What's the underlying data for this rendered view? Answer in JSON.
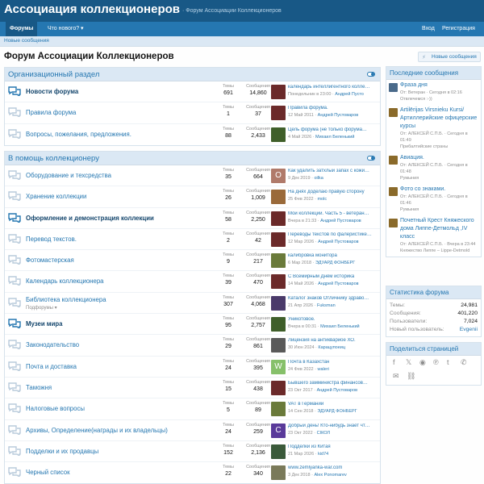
{
  "header": {
    "title": "Ассоциация коллекционеров",
    "subtitle": "· Форум Ассоциации Коллекционеров"
  },
  "nav": {
    "tabs": [
      {
        "label": "Форумы",
        "active": true
      },
      {
        "label": "Что нового? ▾",
        "active": false
      }
    ],
    "login": "Вход",
    "register": "Регистрация"
  },
  "subnav": {
    "item": "Новые сообщения"
  },
  "page": {
    "title": "Форум Ассоциации Коллекционеров",
    "new_posts_button": "Новые сообщения"
  },
  "labels": {
    "threads": "Темы",
    "messages": "Сообщения"
  },
  "colors": {
    "accent": "#2577b1",
    "header": "#185886",
    "nav": "#2577b1"
  },
  "categories": [
    {
      "title": "Организационный раздел",
      "nodes": [
        {
          "title": "Новости форума",
          "unread": true,
          "threads": "691",
          "messages": "14,860",
          "last_title": "календарь интеллигентного колле…",
          "last_date": "Понедельник в 23:00",
          "last_user": "Андрей Пусто",
          "avatar_color": "#6b2a2a",
          "avatar_letter": ""
        },
        {
          "title": "Правила форума",
          "unread": false,
          "threads": "1",
          "messages": "37",
          "last_title": "Правила форума.",
          "last_date": "12 Май 2011",
          "last_user": "Андрей Пустоваров",
          "avatar_color": "#6b2a2a",
          "avatar_letter": ""
        },
        {
          "title": "Вопросы, пожелания, предложения.",
          "unread": false,
          "threads": "88",
          "messages": "2,433",
          "last_title": "Цель форума (не только форума…",
          "last_date": "4 Май 2026",
          "last_user": "Михаил Беленький",
          "avatar_color": "#3f5f2a",
          "avatar_letter": ""
        }
      ]
    },
    {
      "title": "В помощь коллекционеру",
      "nodes": [
        {
          "title": "Оборудование и техсредства",
          "unread": false,
          "threads": "35",
          "messages": "664",
          "last_title": "Как удалить затхлый запах с кожи…",
          "last_date": "9 Дек 2019",
          "last_user": "oilka",
          "avatar_color": "#b07a6a",
          "avatar_letter": "O"
        },
        {
          "title": "Хранение коллекции",
          "unread": false,
          "threads": "26",
          "messages": "1,009",
          "last_title": "На днях доделаю правую сторону",
          "last_date": "25 Фев 2022",
          "last_user": "molc",
          "avatar_color": "#9a6a3a",
          "avatar_letter": ""
        },
        {
          "title": "Оформление и демонстрация коллекции",
          "unread": true,
          "threads": "58",
          "messages": "2,250",
          "last_title": "Мои коллекции. Часть 5 - ветеран…",
          "last_date": "Вчера в 21:33",
          "last_user": "Андрей Пустоваров",
          "avatar_color": "#6b2a2a",
          "avatar_letter": ""
        },
        {
          "title": "Перевод текстов.",
          "unread": false,
          "threads": "2",
          "messages": "42",
          "last_title": "Переводы текстов по фалеристике…",
          "last_date": "12 Мар 2026",
          "last_user": "Андрей Пустоваров",
          "avatar_color": "#6b2a2a",
          "avatar_letter": ""
        },
        {
          "title": "Фотомастерская",
          "unread": false,
          "threads": "9",
          "messages": "217",
          "last_title": "калибровка монитора",
          "last_date": "6 Мар 2018",
          "last_user": "ЭДУАРД ФОНБЕРГ",
          "avatar_color": "#6a7a3a",
          "avatar_letter": ""
        },
        {
          "title": "Календарь коллекционера",
          "unread": false,
          "threads": "39",
          "messages": "470",
          "last_title": "С Всемирным Днём историка",
          "last_date": "14 Май 2026",
          "last_user": "Андрей Пустоваров",
          "avatar_color": "#6b2a2a",
          "avatar_letter": ""
        },
        {
          "title": "Библиотека коллекционера",
          "subforums": "Подфорумы ▾",
          "unread": false,
          "threads": "307",
          "messages": "4,068",
          "last_title": "Каталог знаков Отличнику здраво…",
          "last_date": "21 Апр 2026",
          "last_user": "Fuksman",
          "avatar_color": "#4a3a6a",
          "avatar_letter": ""
        },
        {
          "title": "Музеи мира",
          "unread": true,
          "threads": "95",
          "messages": "2,757",
          "last_title": "Уникотовое.",
          "last_date": "Вчера в 00:31",
          "last_user": "Михаил Беленький",
          "avatar_color": "#3f5f2a",
          "avatar_letter": ""
        },
        {
          "title": "Законодательство",
          "unread": false,
          "threads": "29",
          "messages": "861",
          "last_title": "Лицензия на антиквариое ХО.",
          "last_date": "30 Июн 2024",
          "last_user": "Карацупоеиц",
          "avatar_color": "#5a5a5a",
          "avatar_letter": ""
        },
        {
          "title": "Почта и доставка",
          "unread": false,
          "threads": "24",
          "messages": "395",
          "last_title": "Почта в Казахстан",
          "last_date": "24 Фев 2022",
          "last_user": "waleri",
          "avatar_color": "#86c06a",
          "avatar_letter": "W"
        },
        {
          "title": "Таможня",
          "unread": false,
          "threads": "15",
          "messages": "438",
          "last_title": "Бывшего замминистра финансов…",
          "last_date": "23 Окт 2017",
          "last_user": "Андрей Пустоваров",
          "avatar_color": "#6b2a2a",
          "avatar_letter": ""
        },
        {
          "title": "Налоговые вопросы",
          "unread": false,
          "threads": "5",
          "messages": "89",
          "last_title": "VAT в Германии",
          "last_date": "14 Сен 2018",
          "last_user": "ЭДУАРД ФОНБЕРГ",
          "avatar_color": "#6a7a3a",
          "avatar_letter": ""
        },
        {
          "title": "Архивы, Определение(награды и их владельцы)",
          "unread": false,
          "threads": "24",
          "messages": "259",
          "last_title": "Добрый день! Кто-нибудь знает чт…",
          "last_date": "23 Окт 2022",
          "last_user": "СІКОЛ",
          "avatar_color": "#5a3a9a",
          "avatar_letter": "С"
        },
        {
          "title": "Подделки и их продавцы",
          "unread": false,
          "threads": "152",
          "messages": "2,136",
          "last_title": "Подделки из Китая",
          "last_date": "21 Мар 2026",
          "last_user": "kid74",
          "avatar_color": "#3a5a3a",
          "avatar_letter": ""
        },
        {
          "title": "Черный список",
          "unread": false,
          "threads": "22",
          "messages": "340",
          "last_title": "www.zemlyanka-war.com",
          "last_date": "3 Дек 2018",
          "last_user": "Alex Ponomarev",
          "avatar_color": "#7a7a5a",
          "avatar_letter": ""
        }
      ]
    }
  ],
  "sidebar": {
    "new_posts": {
      "title": "Последние сообщения",
      "items": [
        {
          "title": "Фраза дня",
          "meta": "От: Ветеран · Сегодня в 02:16",
          "sub": "Отвлечемся :-))",
          "avatar_color": "#4a6a8a"
        },
        {
          "title": "Artilērijas Virsnieku Kursi/ Артиллерийские офицерские курсы",
          "meta": "От: АЛЕКСЕЙ С.П.Б. · Сегодня в 01:49",
          "sub": "Прибалтийские страны",
          "avatar_color": "#8a6a2a"
        },
        {
          "title": "Авиация.",
          "meta": "От: АЛЕКСЕЙ С.П.Б. · Сегодня в 01:48",
          "sub": "Румыния",
          "avatar_color": "#8a6a2a"
        },
        {
          "title": "Фото со знаками.",
          "meta": "От: АЛЕКСЕЙ С.П.Б. · Сегодня в 01:46",
          "sub": "Румыния",
          "avatar_color": "#8a6a2a"
        },
        {
          "title": "Почетный Крест Княжеского дома Липпе-Детмольд ,IV класс",
          "meta": "От: АЛЕКСЕЙ С.П.Б. · Вчера в 23:44",
          "sub": "Княжество Липпе – Lippe-Detmold",
          "avatar_color": "#8a6a2a"
        }
      ]
    },
    "stats": {
      "title": "Статистика форума",
      "rows": [
        {
          "label": "Темы:",
          "value": "24,981"
        },
        {
          "label": "Сообщения:",
          "value": "401,220"
        },
        {
          "label": "Пользователи:",
          "value": "7,024"
        },
        {
          "label": "Новый пользователь:",
          "value": "Evgenii"
        }
      ]
    },
    "share": {
      "title": "Поделиться страницей",
      "icons": [
        "facebook-icon",
        "x-icon",
        "reddit-icon",
        "pinterest-icon",
        "tumblr-icon",
        "whatsapp-icon",
        "email-icon",
        "link-icon"
      ]
    }
  }
}
